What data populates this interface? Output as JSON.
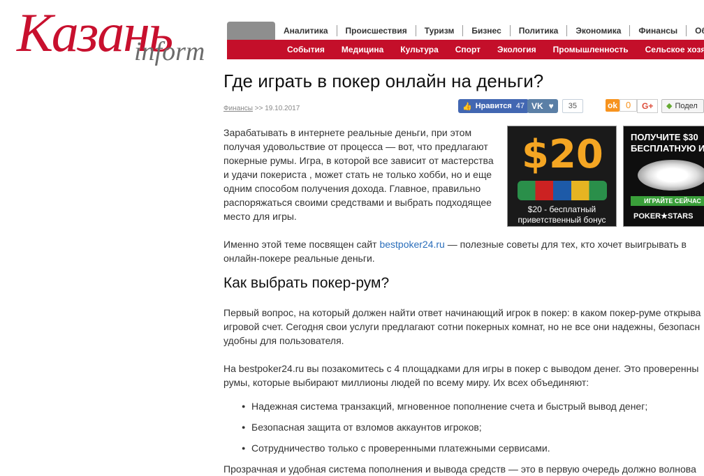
{
  "logo": {
    "main": "Казань",
    "sub": "inform"
  },
  "nav": {
    "primary": [
      "Аналитика",
      "Происшествия",
      "Туризм",
      "Бизнес",
      "Политика",
      "Экономика",
      "Финансы",
      "Обр"
    ],
    "secondary": [
      "События",
      "Медицина",
      "Культура",
      "Спорт",
      "Экология",
      "Промышленность",
      "Сельское хозяйс"
    ]
  },
  "article": {
    "title": "Где играть в покер онлайн на деньги?",
    "category": "Финансы",
    "separator": ">>",
    "date": "19.10.2017",
    "p1": "Зарабатывать в интернете реальные деньги, при этом получая удовольствие от процесса — вот, что предлагают покерные румы. Игра, в которой все зависит от мастерства и удачи покериста , может стать не только хобби, но и еще одним способом получения дохода. Главное, правильно распоряжаться своими средствами и выбрать подходящее место для игры.",
    "p2_before": "Именно этой теме посвящен сайт ",
    "p2_link": "bestpoker24.ru",
    "p2_after": " — полезные советы для тех, кто хочет выигрывать в онлайн-покере реальные деньги.",
    "h2": "Как выбрать покер-рум?",
    "p3": "Первый вопрос, на который должен найти ответ начинающий игрок в покер: в каком покер-руме открыва игровой счет. Сегодня свои услуги предлагают сотни покерных комнат, но не все они надежны, безопасн удобны для пользователя.",
    "p4": "На bestpoker24.ru вы позакомитесь с 4 площадками для игры в покер с выводом денег. Это проверенны румы, которые выбирают миллионы людей по всему миру. Их всех объединяют:",
    "bullets": [
      "Надежная система транзакций, мгновенное пополнение счета и быстрый вывод денег;",
      "Безопасная защита от взломов аккаунтов игроков;",
      "Сотрудничество только с проверенными платежными сервисами."
    ],
    "p5": "Прозрачная и удобная система пополнения и вывода средств — это в первую очередь должно волнова"
  },
  "social": {
    "fb_label": "Нравится",
    "fb_count": "47",
    "vk_count": "35",
    "ok_count": "0",
    "gplus": "G+",
    "share_label": "Подел"
  },
  "banners": {
    "b1_amount": "$20",
    "b1_caption": "$20 - бесплатный приветственный бонус",
    "b2_line1": "ПОЛУЧИТЕ $30",
    "b2_line2": "БЕСПЛАТНУЮ И",
    "b2_play": "ИГРАЙТЕ СЕЙЧАС",
    "b2_brand": "POKER★STARS"
  }
}
